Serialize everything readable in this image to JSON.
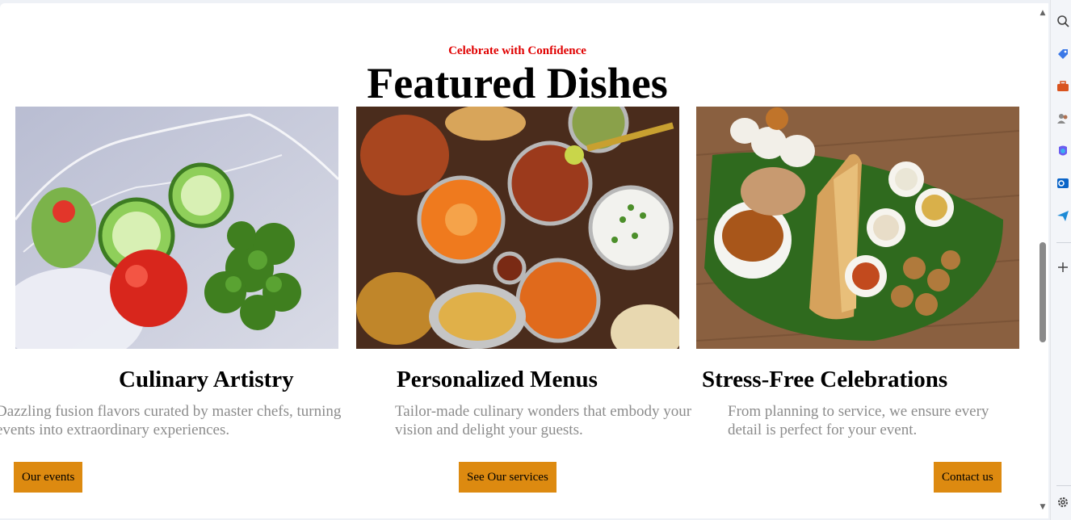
{
  "section": {
    "kicker": "Celebrate with Confidence",
    "title": "Featured Dishes"
  },
  "cards": [
    {
      "image": "vegetable-splash-photo",
      "title": "Culinary Artistry",
      "description": "Dazzling fusion flavors curated by master chefs, turning events into extraordinary experiences.",
      "button": "Our events"
    },
    {
      "image": "indian-curry-spread-photo",
      "title": "Personalized Menus",
      "description": "Tailor-made culinary wonders that embody your vision and delight your guests.",
      "button": "See Our services"
    },
    {
      "image": "south-indian-dosa-platter-photo",
      "title": "Stress-Free Celebrations",
      "description": "From planning to service, we ensure every detail is perfect for your event.",
      "button": "Contact us"
    }
  ],
  "colors": {
    "kicker": "#e00000",
    "button_bg": "#dd8a10",
    "description_text": "#8c8c8c"
  },
  "sidebar_icons": [
    "search-icon",
    "tag-icon",
    "briefcase-icon",
    "people-icon",
    "copilot-icon",
    "outlook-icon",
    "send-icon",
    "add-icon",
    "settings-icon"
  ]
}
